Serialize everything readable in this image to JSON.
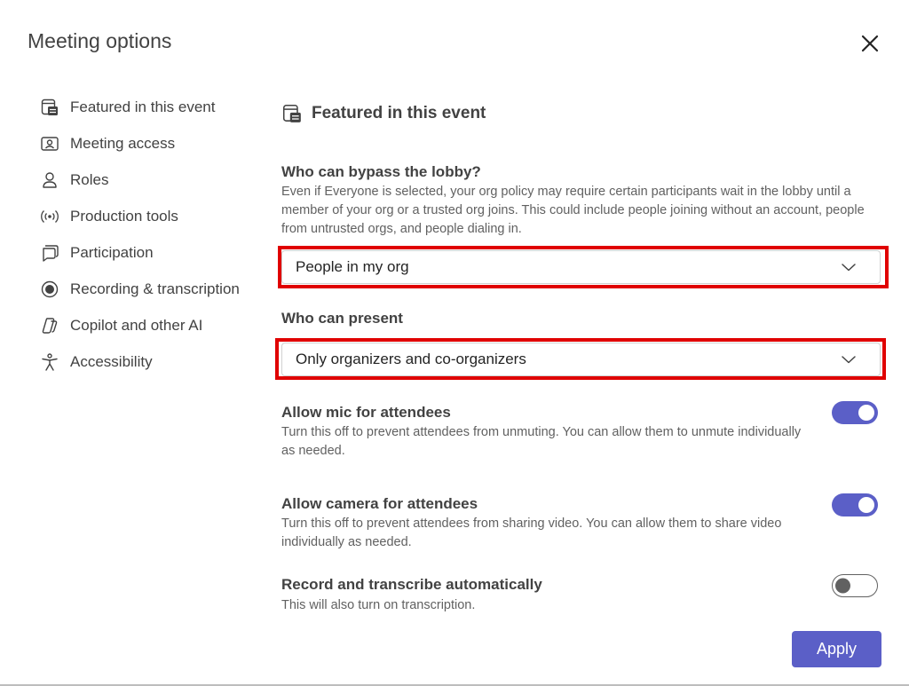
{
  "dialog": {
    "title": "Meeting options"
  },
  "sidebar": {
    "items": [
      {
        "label": "Featured in this event",
        "icon": "calendar-featured-icon"
      },
      {
        "label": "Meeting access",
        "icon": "person-card-icon"
      },
      {
        "label": "Roles",
        "icon": "person-icon"
      },
      {
        "label": "Production tools",
        "icon": "broadcast-icon"
      },
      {
        "label": "Participation",
        "icon": "chat-bubbles-icon"
      },
      {
        "label": "Recording & transcription",
        "icon": "record-icon"
      },
      {
        "label": "Copilot and other AI",
        "icon": "copilot-icon"
      },
      {
        "label": "Accessibility",
        "icon": "accessibility-icon"
      }
    ]
  },
  "main": {
    "heading": "Featured in this event",
    "lobby": {
      "label": "Who can bypass the lobby?",
      "description": "Even if Everyone is selected, your org policy may require certain participants wait in the lobby until a member of your org or a trusted org joins. This could include people joining without an account, people from untrusted orgs, and people dialing in.",
      "value": "People in my org"
    },
    "present": {
      "label": "Who can present",
      "value": "Only organizers and co-organizers"
    },
    "mic": {
      "label": "Allow mic for attendees",
      "description": "Turn this off to prevent attendees from unmuting. You can allow them to unmute individually as needed.",
      "enabled": true
    },
    "camera": {
      "label": "Allow camera for attendees",
      "description": "Turn this off to prevent attendees from sharing video. You can allow them to share video individually as needed.",
      "enabled": true
    },
    "record": {
      "label": "Record and transcribe automatically",
      "description": "This will also turn on transcription.",
      "enabled": false
    }
  },
  "footer": {
    "apply_label": "Apply"
  },
  "colors": {
    "accent": "#5b5fc7",
    "highlight": "#e00000",
    "text": "#424242",
    "muted": "#616161"
  }
}
